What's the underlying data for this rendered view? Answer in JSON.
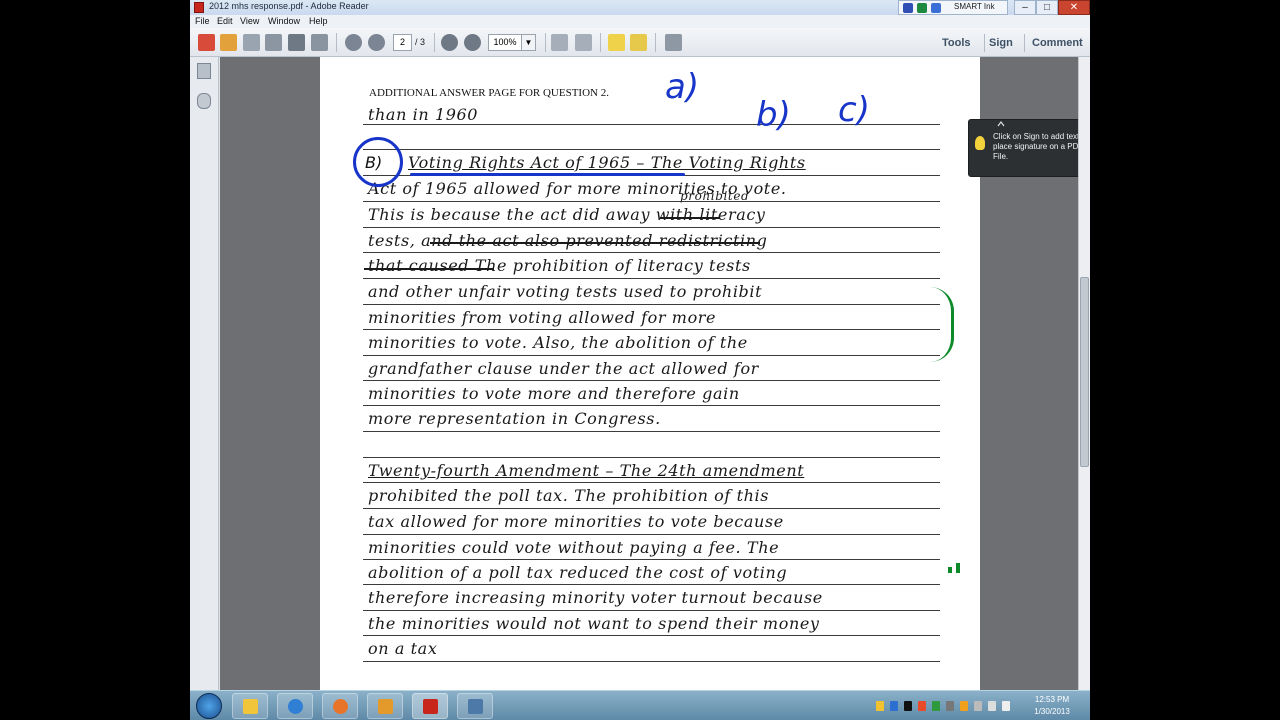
{
  "window": {
    "title": "2012 mhs response.pdf - Adobe Reader",
    "smart_ink_label": "SMART Ink"
  },
  "menu": [
    "File",
    "Edit",
    "View",
    "Window",
    "Help"
  ],
  "toolbar": {
    "page_current": "2",
    "page_total": "/ 3",
    "zoom": "100%",
    "tools_label": "Tools",
    "sign_label": "Sign",
    "comment_label": "Comment"
  },
  "tooltip": {
    "text": "Click on Sign to add text and place signature on a PDF File."
  },
  "page": {
    "header": "ADDITIONAL ANSWER PAGE FOR QUESTION 2.",
    "annotations": {
      "a": "a)",
      "b": "b)",
      "c": "c)",
      "circled": "B)"
    },
    "lines": [
      "than in 1960",
      "Voting Rights Act of 1965 – The Voting Rights",
      "Act of 1965 allowed for more minorities to vote.",
      "This is because the act did away with literacy",
      "tests, and the act also prevented redistricting",
      "that caused The prohibition of literacy tests",
      "and other unfair voting tests used to prohibit",
      "minorities from voting allowed for more",
      "minorities to vote. Also, the abolition of the",
      "grandfather clause under the act allowed for",
      "minorities to vote more and therefore gain",
      "more representation in Congress.",
      "",
      "Twenty-fourth Amendment – The 24th amendment",
      "prohibited the poll tax. The prohibition of this",
      "tax allowed for more minorities to vote because",
      "minorities could vote without paying a fee. The",
      "abolition of a poll tax reduced the cost of voting",
      "therefore increasing minority voter turnout because",
      "the minorities would not want to spend their money",
      "on a tax"
    ],
    "insert_above": "prohibited"
  },
  "taskbar": {
    "time": "12:53 PM",
    "date": "1/30/2013"
  },
  "colors": {
    "annotation_blue": "#1735c8",
    "annotation_green": "#0c8a2a"
  }
}
